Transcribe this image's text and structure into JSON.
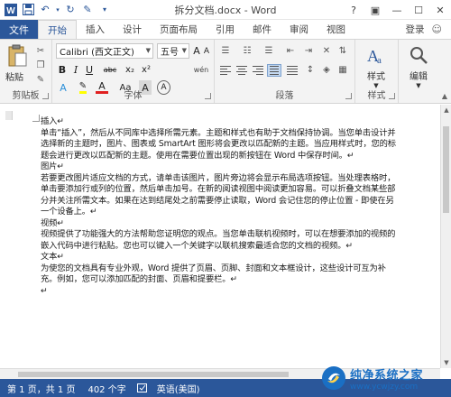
{
  "window": {
    "title": "拆分文档.docx - Word",
    "controls": [
      "?",
      "▣",
      "—",
      "☐",
      "✕"
    ]
  },
  "tabs": {
    "file": "文件",
    "items": [
      "开始",
      "插入",
      "设计",
      "页面布局",
      "引用",
      "邮件",
      "审阅",
      "视图"
    ],
    "active": "开始",
    "login": "登录"
  },
  "ribbon": {
    "clipboard": {
      "paste": "粘贴",
      "label": "剪贴板"
    },
    "font": {
      "font_name": "Calibri (西文正文)",
      "font_size": "五号",
      "wen": "wén",
      "label": "字体",
      "buttons": [
        "B",
        "I",
        "U",
        "abc",
        "x₂",
        "x²",
        "A",
        "A",
        "Aa",
        "A",
        "A"
      ]
    },
    "paragraph": {
      "label": "段落"
    },
    "styles": {
      "button": "样式",
      "label": "样式"
    },
    "editing": {
      "button": "编辑"
    }
  },
  "document": {
    "paragraphs": [
      "插入↵",
      "单击“插入”，然后从不同库中选择所需元素。主题和样式也有助于文档保持协调。当您单击设计并选择新的主题时，图片、图表或 SmartArt 图形将会更改以匹配新的主题。当应用样式时，您的标题会进行更改以匹配新的主题。使用在需要位置出现的新按钮在 Word 中保存时间。↵",
      "图片↵",
      "若要更改图片适应文档的方式，请单击该图片，图片旁边将会显示布局选项按钮。当处理表格时，单击要添加行或列的位置，然后单击加号。在新的阅读视图中阅读更加容易。可以折叠文档某些部分并关注所需文本。如果在达到结尾处之前需要停止读取，Word 会记住您的停止位置 - 即使在另一个设备上。↵",
      "视频↵",
      "视频提供了功能强大的方法帮助您证明您的观点。当您单击联机视频时，可以在想要添加的视频的嵌入代码中进行粘贴。您也可以键入一个关键字以联机搜索最适合您的文档的视频。↵",
      "文本↵",
      "为使您的文档具有专业外观，Word 提供了页眉、页脚、封面和文本框设计，这些设计可互为补充。例如，您可以添加匹配的封面、页眉和提要栏。↵",
      "↵"
    ]
  },
  "status": {
    "page": "第 1 页，共 1 页",
    "words": "402 个字",
    "language": "英语(美国)"
  },
  "watermark": {
    "title": "纯净系统之家",
    "url": "www.ycwjzy.com"
  },
  "colors": {
    "accent": "#2b579a",
    "ribbon_bg": "#f3f3f3"
  }
}
